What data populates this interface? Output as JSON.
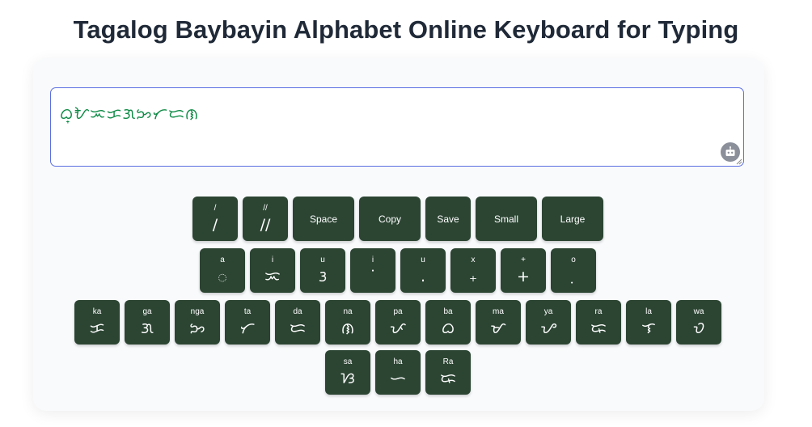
{
  "page": {
    "title": "Tagalog Baybayin Alphabet Online Keyboard for Typing"
  },
  "editor": {
    "text": "ᜊ᜔ᜀᜁᜃᜄᜅᜆᜇᜈ",
    "bot_icon": "robot-icon"
  },
  "rows": {
    "row1": [
      {
        "label": "/",
        "char": "/"
      },
      {
        "label": "//",
        "char": "//"
      },
      {
        "text": "Space"
      },
      {
        "text": "Copy"
      },
      {
        "text": "Save"
      },
      {
        "text": "Small"
      },
      {
        "text": "Large"
      }
    ],
    "row2": [
      {
        "label": "a",
        "char": "ᜀ"
      },
      {
        "label": "i",
        "char": "ᜁ"
      },
      {
        "label": "u",
        "char": "ᜂ"
      },
      {
        "label": "i",
        "char": "˙"
      },
      {
        "label": "u",
        "char": "."
      },
      {
        "label": "x",
        "char": "₊"
      },
      {
        "label": "+",
        "char": "+"
      },
      {
        "label": "o",
        "char": "ᜓ"
      }
    ],
    "row3": [
      {
        "label": "ka",
        "char": "ᜃ"
      },
      {
        "label": "ga",
        "char": "ᜄ"
      },
      {
        "label": "nga",
        "char": "ᜅ"
      },
      {
        "label": "ta",
        "char": "ᜆ"
      },
      {
        "label": "da",
        "char": "ᜇ"
      },
      {
        "label": "na",
        "char": "ᜈ"
      },
      {
        "label": "pa",
        "char": "ᜉ"
      },
      {
        "label": "ba",
        "char": "ᜊ"
      },
      {
        "label": "ma",
        "char": "ᜋ"
      },
      {
        "label": "ya",
        "char": "ᜌ"
      },
      {
        "label": "ra",
        "char": "ᜍ"
      },
      {
        "label": "la",
        "char": "ᜎ"
      },
      {
        "label": "wa",
        "char": "ᜏ"
      }
    ],
    "row4": [
      {
        "label": "sa",
        "char": "ᜐ"
      },
      {
        "label": "ha",
        "char": "ᜑ"
      },
      {
        "label": "Ra",
        "char": "ᜍ"
      }
    ]
  },
  "colors": {
    "key_bg": "#2c4533",
    "editor_text": "#0d8a45",
    "editor_border": "#5b6ee1"
  }
}
